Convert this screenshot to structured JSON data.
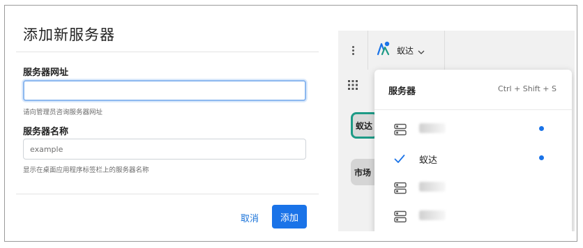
{
  "dialog": {
    "title": "添加新服务器",
    "url_label": "服务器网址",
    "url_value": "",
    "url_placeholder": "",
    "url_hint": "请向管理员咨询服务器网址",
    "name_label": "服务器名称",
    "name_value": "",
    "name_placeholder": "example",
    "name_hint": "显示在桌面应用程序标签栏上的服务器名称",
    "cancel_label": "取消",
    "add_label": "添加"
  },
  "app": {
    "current_server": "蚁达",
    "teams": [
      "蚁达",
      "市场"
    ],
    "add_team_label": "+"
  },
  "menu": {
    "title": "服务器",
    "shortcut": "Ctrl + Shift + S",
    "items": [
      {
        "label": "",
        "icon": "server-icon",
        "unread": true,
        "obscured": true
      },
      {
        "label": "蚁达",
        "icon": "check-icon",
        "unread": true,
        "obscured": false
      },
      {
        "label": "",
        "icon": "server-icon",
        "unread": false,
        "obscured": true
      },
      {
        "label": "",
        "icon": "server-icon",
        "unread": false,
        "obscured": true
      }
    ]
  },
  "colors": {
    "primary": "#1a73e8",
    "active_team_border": "#1d9a86",
    "unread_dot": "#1a73e8"
  }
}
